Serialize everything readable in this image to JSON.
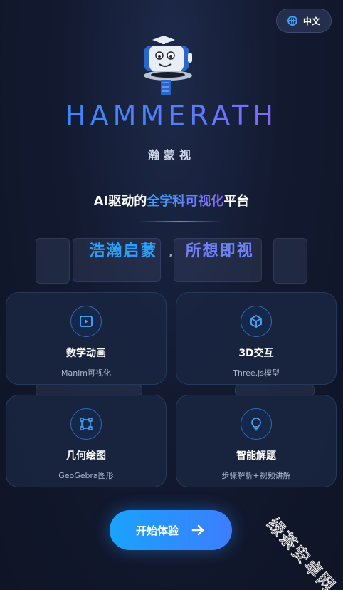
{
  "lang_button": {
    "label": "中文",
    "icon": "globe-icon"
  },
  "brand": {
    "title": "HAMMERATH",
    "subtitle": "瀚蒙视"
  },
  "tagline": {
    "prefix": "AI驱动的",
    "highlight": "全学科可视化",
    "suffix": "平台"
  },
  "slogan": {
    "part1": "浩瀚启蒙",
    "separator": ",",
    "part2": "所想即视"
  },
  "features": [
    {
      "title": "数学动画",
      "desc": "Manim可视化",
      "icon": "play-icon"
    },
    {
      "title": "3D交互",
      "desc": "Three.js模型",
      "icon": "cube-icon"
    },
    {
      "title": "几何绘图",
      "desc": "GeoGebra图形",
      "icon": "vector-square-icon"
    },
    {
      "title": "智能解题",
      "desc": "步骤解析+视频讲解",
      "icon": "lightbulb-icon"
    }
  ],
  "start_button": {
    "label": "开始体验",
    "icon": "arrow-right-icon"
  },
  "watermark": "绿茶安卓网",
  "colors": {
    "accent": "#2aa0ff",
    "accent2": "#6f83ff",
    "card_border": "#233a60"
  }
}
